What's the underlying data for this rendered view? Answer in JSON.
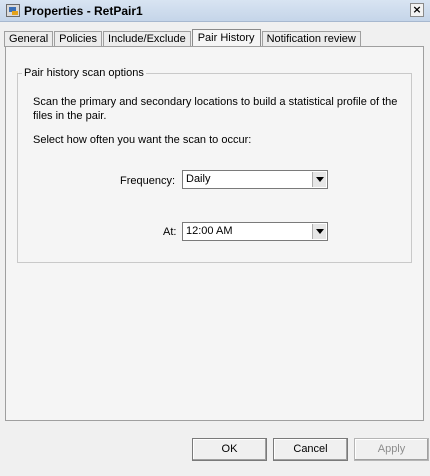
{
  "window": {
    "title": "Properties - RetPair1"
  },
  "tabs": [
    {
      "label": "General"
    },
    {
      "label": "Policies"
    },
    {
      "label": "Include/Exclude"
    },
    {
      "label": "Pair History",
      "active": true
    },
    {
      "label": "Notification review"
    }
  ],
  "pair_history": {
    "group_title": "Pair history scan options",
    "description": "Scan the primary and secondary locations to build a statistical profile of the files in the pair.",
    "instruction": "Select how often you want the scan to occur:",
    "frequency": {
      "label": "Frequency:",
      "value": "Daily"
    },
    "at": {
      "label": "At:",
      "value": "12:00 AM"
    }
  },
  "buttons": {
    "ok": "OK",
    "cancel": "Cancel",
    "apply": "Apply"
  }
}
